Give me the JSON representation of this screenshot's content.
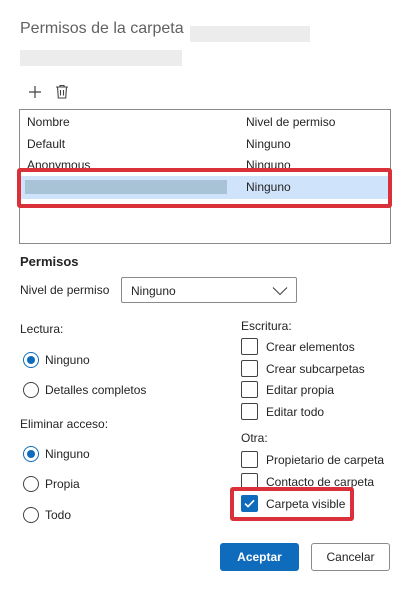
{
  "dialog": {
    "title": "Permisos de la carpeta"
  },
  "toolbar": {
    "add_icon": "plus-icon",
    "delete_icon": "trash-icon"
  },
  "table": {
    "headers": [
      "Nombre",
      "Nivel de permiso"
    ],
    "rows": [
      {
        "name": "Default",
        "level": "Ninguno"
      },
      {
        "name": "Anonymous",
        "level": "Ninguno"
      },
      {
        "name": "",
        "level": "Ninguno",
        "selected": true
      }
    ]
  },
  "permissions": {
    "title": "Permisos",
    "level_label": "Nivel de permiso",
    "level_value": "Ninguno",
    "read": {
      "label": "Lectura:",
      "options": [
        {
          "label": "Ninguno",
          "checked": true
        },
        {
          "label": "Detalles completos",
          "checked": false
        }
      ]
    },
    "delete_access": {
      "label": "Eliminar acceso:",
      "options": [
        {
          "label": "Ninguno",
          "checked": true
        },
        {
          "label": "Propia",
          "checked": false
        },
        {
          "label": "Todo",
          "checked": false
        }
      ]
    },
    "write": {
      "label": "Escritura:",
      "options": [
        {
          "label": "Crear elementos",
          "checked": false
        },
        {
          "label": "Crear subcarpetas",
          "checked": false
        },
        {
          "label": "Editar propia",
          "checked": false
        },
        {
          "label": "Editar todo",
          "checked": false
        }
      ]
    },
    "other": {
      "label": "Otra:",
      "options": [
        {
          "label": "Propietario de carpeta",
          "checked": false
        },
        {
          "label": "Contacto de carpeta",
          "checked": false
        },
        {
          "label": "Carpeta visible",
          "checked": true
        }
      ]
    }
  },
  "buttons": {
    "accept": "Aceptar",
    "cancel": "Cancelar"
  },
  "colors": {
    "accent": "#0f6cbd",
    "highlight": "#d9303a",
    "selected_row": "#cfe4fa"
  }
}
